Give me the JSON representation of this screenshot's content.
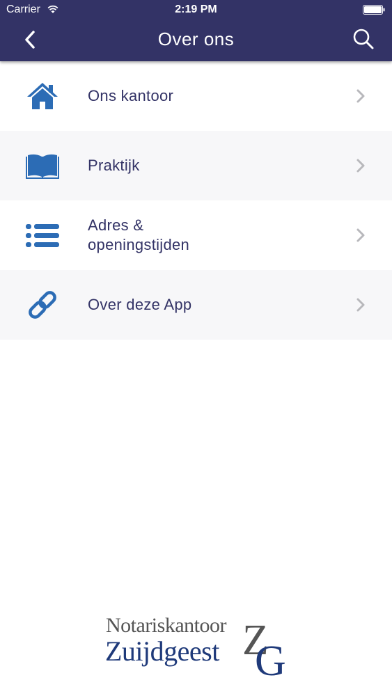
{
  "status": {
    "carrier": "Carrier",
    "time": "2:19 PM"
  },
  "nav": {
    "title": "Over ons",
    "back_icon": "chevron-left-icon",
    "search_icon": "search-icon"
  },
  "menu": {
    "items": [
      {
        "label": "Ons kantoor",
        "icon": "home-icon"
      },
      {
        "label": "Praktijk",
        "icon": "book-icon"
      },
      {
        "label": "Adres &\nopeningstijden",
        "icon": "list-icon"
      },
      {
        "label": "Over deze App",
        "icon": "link-icon"
      }
    ]
  },
  "logo": {
    "line1": "Notariskantoor",
    "line2": "Zuijdgeest",
    "monogram": "ZG"
  },
  "colors": {
    "header": "#333366",
    "icon_blue": "#2c6cb5",
    "text": "#333366",
    "chevron": "#b8b8bc",
    "logo_blue": "#1f3a7a"
  }
}
